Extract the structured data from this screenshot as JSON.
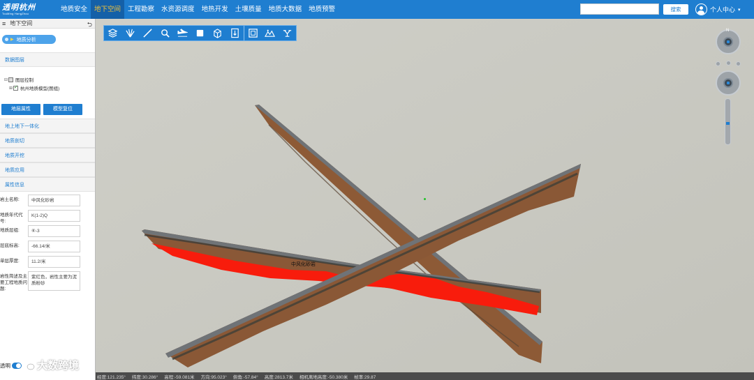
{
  "logo": {
    "cn": "透明杭州",
    "en": "TouMing HangZhou"
  },
  "nav": [
    {
      "label": "地质安全"
    },
    {
      "label": "地下空间"
    },
    {
      "label": "工程勘察"
    },
    {
      "label": "水资源调度"
    },
    {
      "label": "地热开发"
    },
    {
      "label": "土壤质量"
    },
    {
      "label": "地质大数据"
    },
    {
      "label": "地质预警"
    }
  ],
  "search": {
    "placeholder": "",
    "button": "搜索"
  },
  "user": {
    "label": "个人中心",
    "caret": "▾"
  },
  "sidebar": {
    "header": "地下空间",
    "pill": "地质分析",
    "data_layers": "数据图层",
    "tree": [
      {
        "label": "图层控制",
        "exp": "⊟"
      },
      {
        "label": "杭州地质模型(图组)",
        "exp": "⊞"
      }
    ],
    "buttons": {
      "layer_props": "地层属性",
      "model_reset": "模型复位"
    },
    "sections": [
      "地上地下一体化",
      "地质剖切",
      "地质开挖",
      "地质应用",
      "属性信息"
    ],
    "properties": [
      {
        "label": "岩土名称:",
        "value": "中风化砂岩"
      },
      {
        "label": "地质年代代号:",
        "value": "K(1-2)Q"
      },
      {
        "label": "地质层组:",
        "value": "⑥-3"
      },
      {
        "label": "层底标高:",
        "value": "-66.14/米"
      },
      {
        "label": "单层厚度:",
        "value": "11.2/米"
      },
      {
        "label": "岩性简述及主要工程地质问题:",
        "value": "紫红色，岩性主要为泥质粉砂"
      }
    ]
  },
  "map": {
    "label": "中风化砂岩",
    "compass_n": "N"
  },
  "toolbar_icons": [
    "layers-icon",
    "fan-icon",
    "brush-icon",
    "magnifier-icon",
    "plane-icon",
    "square-icon",
    "cube-icon",
    "ruler-icon",
    "frame-icon",
    "landscape-icon",
    "drone-icon"
  ],
  "status": [
    "经度:121.235°",
    "纬度:30.286°",
    "高程:-59.081米",
    "方向:95.023°",
    "俯角:-57.84°",
    "高度:2813.7米",
    "相机离地高度:-50.380米",
    "帧率:29.87"
  ],
  "bottom": {
    "toggle_label": "透明",
    "watermark": "大数跨境"
  },
  "colors": {
    "accent": "#1f7ed0",
    "active_nav_text": "#f3c23a",
    "red_layer": "#f81c0c",
    "brown_layer": "#8a5a3a"
  }
}
